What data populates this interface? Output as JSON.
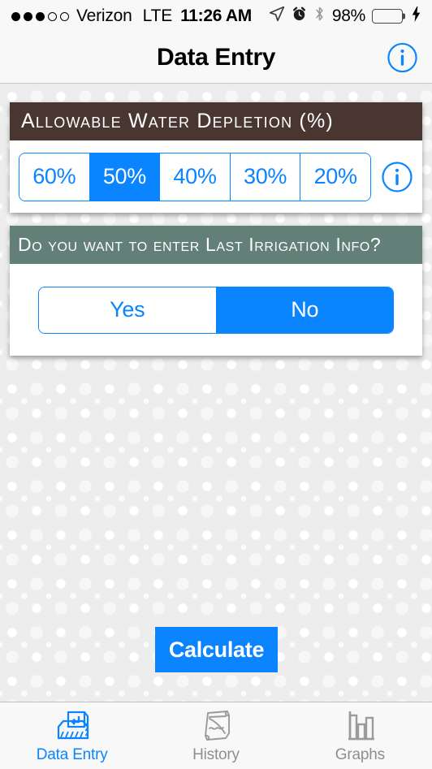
{
  "status_bar": {
    "signal_dots_filled": 3,
    "signal_dots_total": 5,
    "carrier": "Verizon",
    "network_type": "LTE",
    "time": "11:26 AM",
    "battery_percent": "98%",
    "battery_level": 98,
    "battery_color": "#5ddb6a",
    "icons": [
      "location-arrow-icon",
      "alarm-clock-icon",
      "bluetooth-icon",
      "charging-bolt-icon"
    ]
  },
  "nav_bar": {
    "title": "Data Entry",
    "info_button_label": "i"
  },
  "cards": [
    {
      "id": "depletion",
      "header": "Allowable Water Depletion (%)",
      "header_color": "#4a3630",
      "control_type": "segmented",
      "options": [
        "60%",
        "50%",
        "40%",
        "30%",
        "20%"
      ],
      "selected_index": 1,
      "selected_value": "50%",
      "has_info_button": true,
      "info_button_label": "i"
    },
    {
      "id": "irrigation",
      "header": "Do you want to enter Last Irrigation Info?",
      "header_color": "#628078",
      "control_type": "segmented",
      "options": [
        "Yes",
        "No"
      ],
      "selected_index": 1,
      "selected_value": "No",
      "has_info_button": false
    }
  ],
  "main": {
    "calculate_label": "Calculate"
  },
  "tab_bar": {
    "active_index": 0,
    "accent_color": "#0a84ff",
    "inactive_color": "#8e8e93",
    "items": [
      {
        "label": "Data Entry",
        "icon": "data-entry-tray-icon"
      },
      {
        "label": "History",
        "icon": "scroll-icon"
      },
      {
        "label": "Graphs",
        "icon": "bar-chart-icon"
      }
    ]
  },
  "theme": {
    "accent_blue": "#0a84ff",
    "background": "#ededed"
  }
}
